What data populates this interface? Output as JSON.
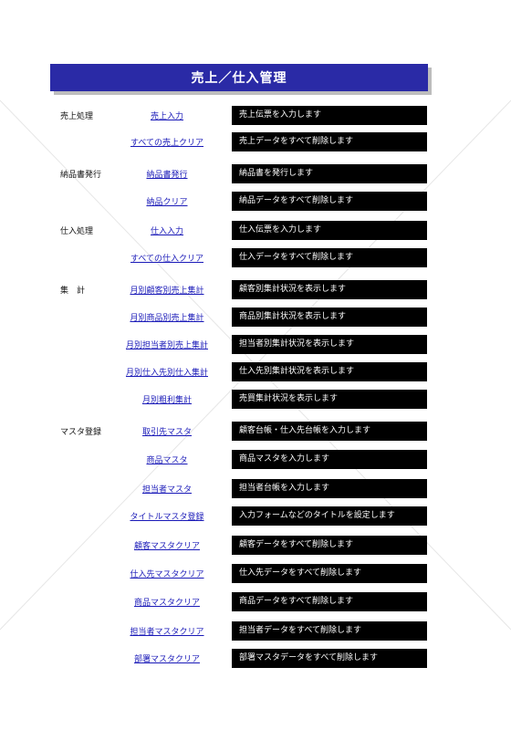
{
  "title": "売上／仕入管理",
  "rows": [
    {
      "category": "売上処理",
      "link": "売上入力",
      "desc": "売上伝票を入力します"
    },
    {
      "category": "",
      "link": "すべての売上クリア",
      "desc": "売上データをすべて削除します"
    },
    {
      "category": "納品書発行",
      "link": "納品書発行",
      "desc": "納品書を発行します"
    },
    {
      "category": "",
      "link": "納品クリア",
      "desc": "納品データをすべて削除します"
    },
    {
      "category": "仕入処理",
      "link": "仕入入力",
      "desc": "仕入伝票を入力します"
    },
    {
      "category": "",
      "link": "すべての仕入クリア",
      "desc": "仕入データをすべて削除します"
    },
    {
      "category": "集　計",
      "link": "月別顧客別売上集計",
      "desc": "顧客別集計状況を表示します"
    },
    {
      "category": "",
      "link": "月別商品別売上集計",
      "desc": "商品別集計状況を表示します"
    },
    {
      "category": "",
      "link": "月別担当者別売上集計",
      "desc": "担当者別集計状況を表示します"
    },
    {
      "category": "",
      "link": "月別仕入先別仕入集計",
      "desc": "仕入先別集計状況を表示します"
    },
    {
      "category": "",
      "link": "月別粗利集計",
      "desc": "売買集計状況を表示します"
    },
    {
      "category": "マスタ登録",
      "link": "取引先マスタ",
      "desc": "顧客台帳・仕入先台帳を入力します"
    },
    {
      "category": "",
      "link": "商品マスタ",
      "desc": "商品マスタを入力します"
    },
    {
      "category": "",
      "link": "担当者マスタ",
      "desc": "担当者台帳を入力します"
    },
    {
      "category": "",
      "link": "タイトルマスタ登録",
      "desc": "入力フォームなどのタイトルを設定します"
    },
    {
      "category": "",
      "link": "顧客マスタクリア",
      "desc": "顧客データをすべて削除します"
    },
    {
      "category": "",
      "link": "仕入先マスタクリア",
      "desc": "仕入先データをすべて削除します"
    },
    {
      "category": "",
      "link": "商品マスタクリア",
      "desc": "商品データをすべて削除します"
    },
    {
      "category": "",
      "link": "担当者マスタクリア",
      "desc": "担当者データをすべて削除します"
    },
    {
      "category": "",
      "link": "部署マスタクリア",
      "desc": "部署マスタデータをすべて削除します"
    }
  ],
  "colors": {
    "title_bg": "#2a2aa6",
    "title_text": "#ffffff",
    "link": "#1a1ab8",
    "desc_bg": "#000000",
    "desc_text": "#ffffff"
  }
}
